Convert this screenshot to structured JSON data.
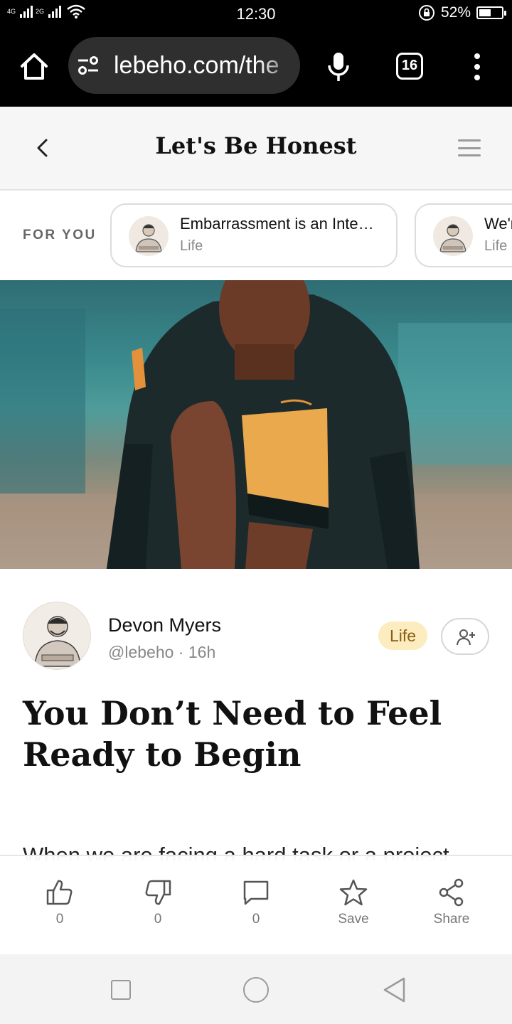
{
  "status_bar": {
    "network_labels": [
      "4G",
      "2G"
    ],
    "time": "12:30",
    "battery_percent": "52%",
    "battery_level": 0.52,
    "icons": [
      "signal-icon",
      "wifi-icon",
      "rotation-lock-icon",
      "battery-icon"
    ]
  },
  "browser": {
    "url": "lebeho.com/the",
    "tab_count": "16",
    "icons": [
      "home-icon",
      "site-settings-icon",
      "microphone-icon",
      "more-menu-icon"
    ]
  },
  "site_header": {
    "title": "Let's Be Honest",
    "icons": [
      "back-icon",
      "hamburger-menu-icon"
    ]
  },
  "for_you": {
    "label": "FOR YOU",
    "cards": [
      {
        "title": "Embarrassment is an Inte…",
        "category": "Life"
      },
      {
        "title": "We're",
        "category": "Life"
      }
    ]
  },
  "post": {
    "author_name": "Devon Myers",
    "author_meta": "@lebeho · 16h",
    "category_tag": "Life",
    "title": "You Don’t Need to Feel Ready to Begin",
    "body_preview": "When we are facing a hard task or a project"
  },
  "actions": [
    {
      "icon": "thumbs-up-icon",
      "label": "0"
    },
    {
      "icon": "thumbs-down-icon",
      "label": "0"
    },
    {
      "icon": "comment-icon",
      "label": "0"
    },
    {
      "icon": "star-icon",
      "label": "Save"
    },
    {
      "icon": "share-icon",
      "label": "Share"
    }
  ],
  "colors": {
    "tag_background": "#fcecc0",
    "tag_text": "#8a5e10",
    "browser_bar": "#000000",
    "url_box": "#2f2f2f"
  }
}
